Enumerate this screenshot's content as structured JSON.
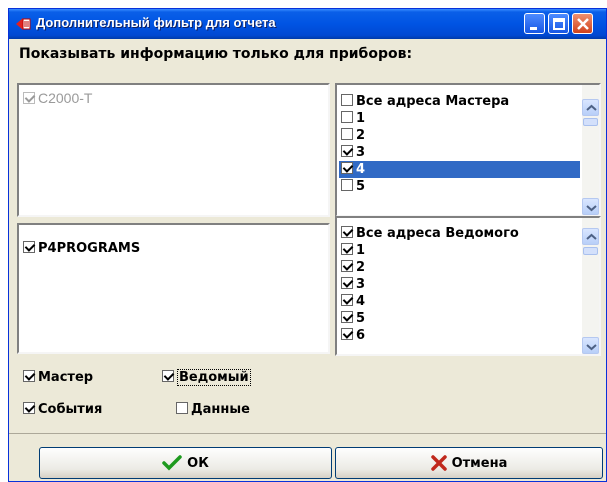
{
  "window": {
    "title": "Дополнительный фильтр для отчета"
  },
  "heading": "Показывать информацию только для приборов:",
  "devices_top": [
    {
      "label": "С2000-Т",
      "checked": true,
      "disabled": true
    }
  ],
  "devices_bottom": [
    {
      "label": "P4PROGRAMS",
      "checked": true
    }
  ],
  "master_list": [
    {
      "label": "Все адреса Мастера",
      "checked": false
    },
    {
      "label": "1",
      "checked": false
    },
    {
      "label": "2",
      "checked": false
    },
    {
      "label": "3",
      "checked": true
    },
    {
      "label": "4",
      "checked": true,
      "selected": true
    },
    {
      "label": "5",
      "checked": false
    }
  ],
  "slave_list": [
    {
      "label": "Все адреса Ведомого",
      "checked": true
    },
    {
      "label": "1",
      "checked": true
    },
    {
      "label": "2",
      "checked": true
    },
    {
      "label": "3",
      "checked": true
    },
    {
      "label": "4",
      "checked": true
    },
    {
      "label": "5",
      "checked": true
    },
    {
      "label": "6",
      "checked": true
    }
  ],
  "options": {
    "master": {
      "label": "Мастер",
      "checked": true
    },
    "slave": {
      "label": "Ведомый",
      "checked": true
    },
    "events": {
      "label": "События",
      "checked": true
    },
    "data": {
      "label": "Данные",
      "checked": false
    }
  },
  "buttons": {
    "ok": "ОК",
    "cancel": "Отмена"
  },
  "colors": {
    "titlebar": "#0054e3",
    "selection": "#316ac5",
    "dialog_bg": "#ece9d8"
  }
}
